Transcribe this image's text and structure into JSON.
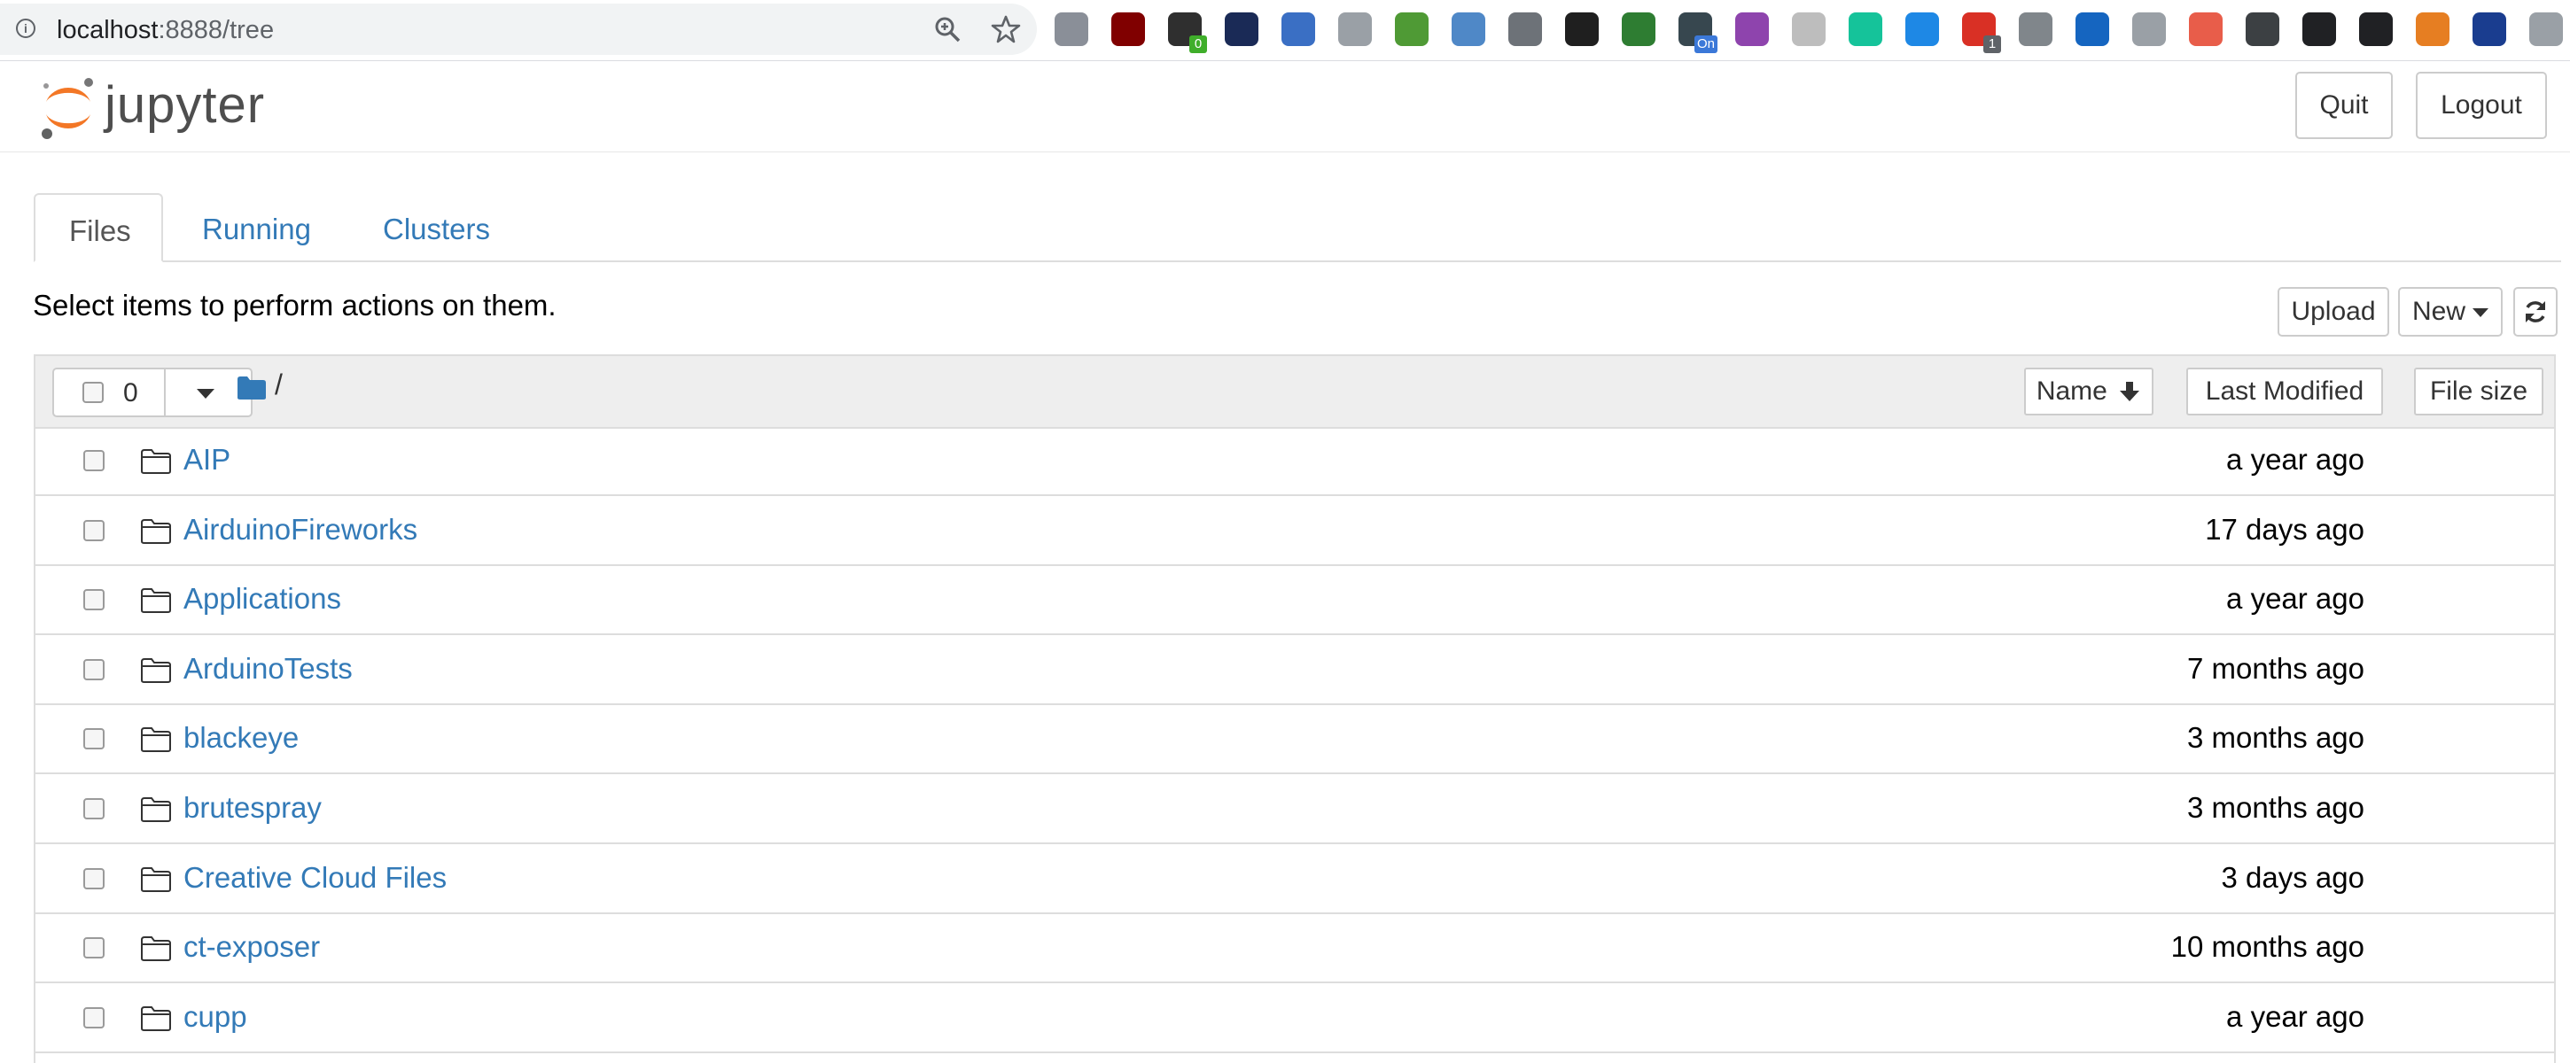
{
  "browser": {
    "url_host": "localhost",
    "url_path": ":8888/tree",
    "extensions": [
      {
        "name": "robot-extension-icon",
        "color": "#8a8f98",
        "badge": ""
      },
      {
        "name": "ublock-origin-icon",
        "color": "#800000",
        "badge": ""
      },
      {
        "name": "tampermonkey-icon",
        "color": "#2f2f2f",
        "badge": "0",
        "badge_color": "#3fae2a"
      },
      {
        "name": "yoroi-icon",
        "color": "#1a2a56",
        "badge": ""
      },
      {
        "name": "globe-icon",
        "color": "#3a6fc4",
        "badge": ""
      },
      {
        "name": "record-icon",
        "color": "#9aa0a6",
        "badge": ""
      },
      {
        "name": "map-pin-icon",
        "color": "#4f9a35",
        "badge": ""
      },
      {
        "name": "screenshot-icon",
        "color": "#4f88c7",
        "badge": ""
      },
      {
        "name": "download-icon",
        "color": "#6d7278",
        "badge": ""
      },
      {
        "name": "terminal-icon",
        "color": "#1f1f1f",
        "badge": ""
      },
      {
        "name": "bitwarden-icon",
        "color": "#2e7d32",
        "badge": ""
      },
      {
        "name": "toggle-on-icon",
        "color": "#37474f",
        "badge": "On",
        "badge_color": "#3b78d8"
      },
      {
        "name": "purple-circle-icon",
        "color": "#8e44ad",
        "badge": ""
      },
      {
        "name": "mc-icon",
        "color": "#bdbdbd",
        "badge": ""
      },
      {
        "name": "grammarly-icon",
        "color": "#15c39a",
        "badge": ""
      },
      {
        "name": "wifi-signal-icon",
        "color": "#1e88e5",
        "badge": ""
      },
      {
        "name": "message-icon",
        "color": "#d93025",
        "badge": "1",
        "badge_color": "#5f6368"
      },
      {
        "name": "google-drive-icon",
        "color": "#80868b",
        "badge": ""
      },
      {
        "name": "eye-icon",
        "color": "#1565c0",
        "badge": ""
      },
      {
        "name": "tag-icon",
        "color": "#9aa0a6",
        "badge": ""
      },
      {
        "name": "qr-icon",
        "color": "#e85d4a",
        "badge": ""
      },
      {
        "name": "graduation-cap-icon",
        "color": "#3c4043",
        "badge": ""
      },
      {
        "name": "share-arrow-icon",
        "color": "#202124",
        "badge": ""
      },
      {
        "name": "audio-icon",
        "color": "#202124",
        "badge": ""
      },
      {
        "name": "rainbow-icon",
        "color": "#e67e22",
        "badge": ""
      },
      {
        "name": "n-box-icon",
        "color": "#1a3d8f",
        "badge": ""
      },
      {
        "name": "camera-icon",
        "color": "#9aa0a6",
        "badge": ""
      }
    ]
  },
  "header": {
    "logo_text": "jupyter",
    "quit_label": "Quit",
    "logout_label": "Logout"
  },
  "tabs": [
    {
      "label": "Files",
      "active": true
    },
    {
      "label": "Running",
      "active": false
    },
    {
      "label": "Clusters",
      "active": false
    }
  ],
  "toolbar": {
    "instructions": "Select items to perform actions on them.",
    "upload_label": "Upload",
    "new_label": "New",
    "refresh_icon": "refresh-icon"
  },
  "list_header": {
    "selected_count": "0",
    "breadcrumb_sep": "/",
    "sort_name": "Name",
    "sort_modified": "Last Modified",
    "sort_size": "File size"
  },
  "items": [
    {
      "name": "AIP",
      "modified": "a year ago"
    },
    {
      "name": "AirduinoFireworks",
      "modified": "17 days ago"
    },
    {
      "name": "Applications",
      "modified": "a year ago"
    },
    {
      "name": "ArduinoTests",
      "modified": "7 months ago"
    },
    {
      "name": "blackeye",
      "modified": "3 months ago"
    },
    {
      "name": "brutespray",
      "modified": "3 months ago"
    },
    {
      "name": "Creative Cloud Files",
      "modified": "3 days ago"
    },
    {
      "name": "ct-exposer",
      "modified": "10 months ago"
    },
    {
      "name": "cupp",
      "modified": "a year ago"
    }
  ],
  "colors": {
    "link": "#337ab7",
    "jupyter_orange": "#f37726",
    "border": "#dddddd",
    "header_bg": "#eeeeee"
  }
}
